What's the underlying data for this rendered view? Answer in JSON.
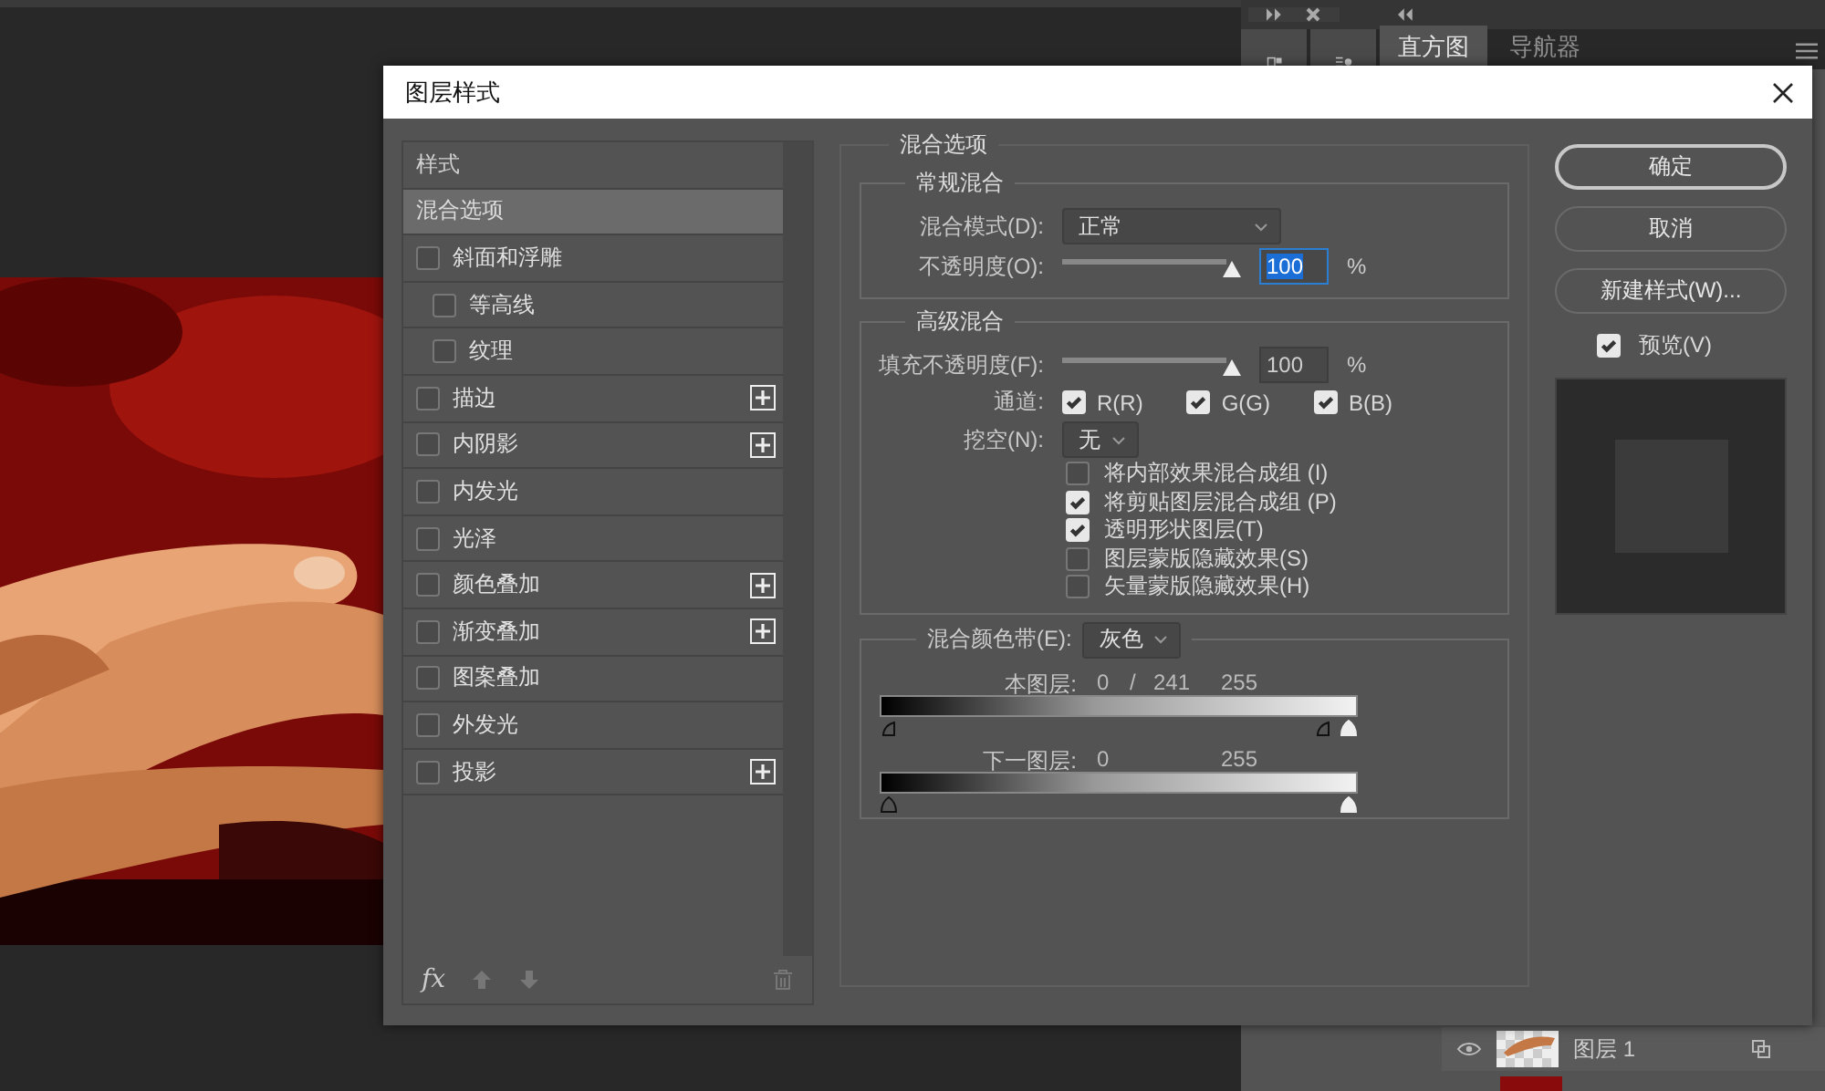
{
  "dock": {
    "panel_tabs": [
      {
        "label": "直方图",
        "selected": true
      },
      {
        "label": "导航器",
        "selected": false
      }
    ],
    "layers": [
      {
        "name": "图层 1"
      }
    ]
  },
  "dialog": {
    "title": "图层样式",
    "styles_header": "样式",
    "styles": [
      {
        "label": "混合选项",
        "kind": "plain",
        "selected": true
      },
      {
        "label": "斜面和浮雕",
        "kind": "check",
        "checked": false,
        "selected": false,
        "add": false,
        "children": [
          {
            "label": "等高线",
            "kind": "check",
            "checked": false,
            "selected": false,
            "add": false
          },
          {
            "label": "纹理",
            "kind": "check",
            "checked": false,
            "selected": false,
            "add": false
          }
        ]
      },
      {
        "label": "描边",
        "kind": "check",
        "checked": false,
        "selected": false,
        "add": true
      },
      {
        "label": "内阴影",
        "kind": "check",
        "checked": false,
        "selected": false,
        "add": true
      },
      {
        "label": "内发光",
        "kind": "check",
        "checked": false,
        "selected": false,
        "add": false
      },
      {
        "label": "光泽",
        "kind": "check",
        "checked": false,
        "selected": false,
        "add": false
      },
      {
        "label": "颜色叠加",
        "kind": "check",
        "checked": false,
        "selected": false,
        "add": true
      },
      {
        "label": "渐变叠加",
        "kind": "check",
        "checked": false,
        "selected": false,
        "add": true
      },
      {
        "label": "图案叠加",
        "kind": "check",
        "checked": false,
        "selected": false,
        "add": false
      },
      {
        "label": "外发光",
        "kind": "check",
        "checked": false,
        "selected": false,
        "add": false
      },
      {
        "label": "投影",
        "kind": "check",
        "checked": false,
        "selected": false,
        "add": true
      }
    ],
    "fx": "fx",
    "blending": {
      "title": "混合选项",
      "general": {
        "title": "常规混合",
        "mode_label": "混合模式(D):",
        "mode": "正常",
        "opacity_label": "不透明度(O):",
        "opacity": {
          "level": 1,
          "value": "100",
          "highlighted": true
        },
        "unit": "%"
      },
      "advanced": {
        "title": "高级混合",
        "fill_label": "填充不透明度(F):",
        "fill": {
          "level": 1,
          "value": "100",
          "highlighted": false
        },
        "unit": "%",
        "channels_label": "通道:",
        "channels": [
          {
            "label": "R(R)",
            "checked": true
          },
          {
            "label": "G(G)",
            "checked": true
          },
          {
            "label": "B(B)",
            "checked": true
          }
        ],
        "knockout_label": "挖空(N):",
        "knockout": "无",
        "options": [
          {
            "label": "将内部效果混合成组 (I)",
            "checked": false
          },
          {
            "label": "将剪贴图层混合成组 (P)",
            "checked": true
          },
          {
            "label": "透明形状图层(T)",
            "checked": true
          },
          {
            "label": "图层蒙版隐藏效果(S)",
            "checked": false
          },
          {
            "label": "矢量蒙版隐藏效果(H)",
            "checked": false
          }
        ]
      },
      "blend_if": {
        "label": "混合颜色带(E):",
        "value": "灰色",
        "bands": [
          {
            "label": "本图层:",
            "readings": [
              "0",
              "/",
              "241",
              "255"
            ],
            "thumbs": [
              {
                "level": 0,
                "kind": "half"
              },
              {
                "level": 0.945,
                "kind": "half"
              },
              {
                "level": 1,
                "kind": "full"
              }
            ]
          },
          {
            "label": "下一图层:",
            "readings": [
              "0",
              "255"
            ],
            "thumbs": [
              {
                "level": 0,
                "kind": "full"
              },
              {
                "level": 1,
                "kind": "full"
              }
            ]
          }
        ]
      }
    },
    "buttons": [
      {
        "label": "确定",
        "default": true
      },
      {
        "label": "取消",
        "default": false
      },
      {
        "label": "新建样式(W)...",
        "default": false
      }
    ],
    "preview": {
      "label": "预览(V)",
      "checked": true
    }
  }
}
